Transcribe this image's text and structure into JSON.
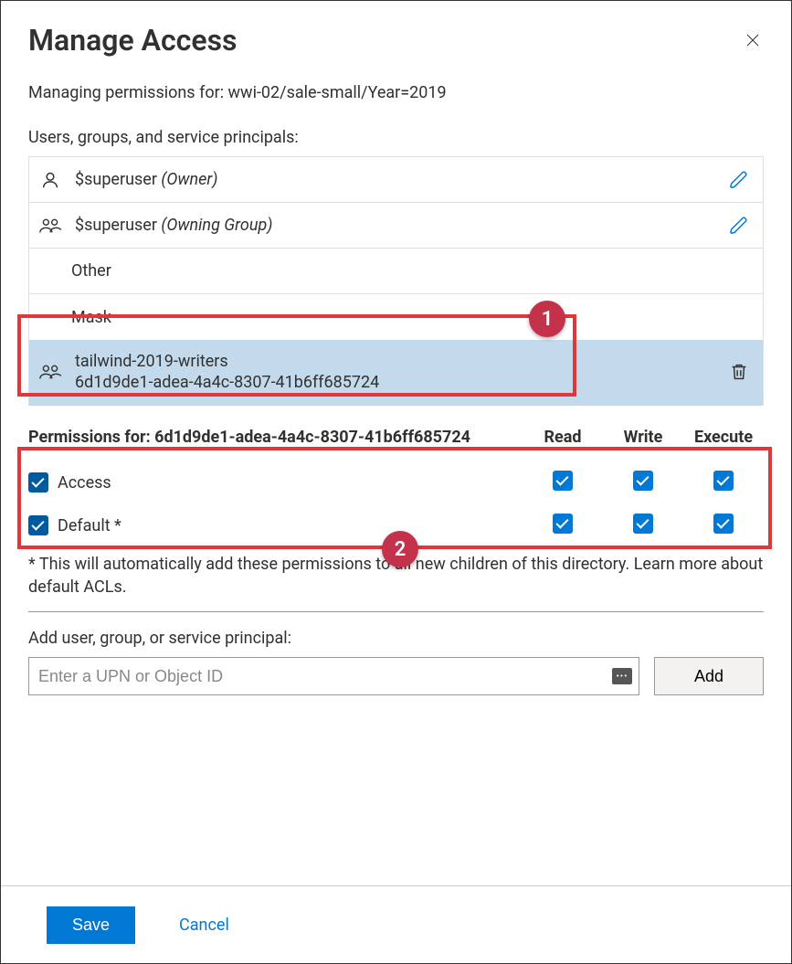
{
  "header": {
    "title": "Manage Access"
  },
  "context_line": "Managing permissions for: wwi-02/sale-small/Year=2019",
  "principals_label": "Users, groups, and service principals:",
  "principals": {
    "owner_name": "$superuser",
    "owner_role": "(Owner)",
    "owning_group_name": "$superuser",
    "owning_group_role": "(Owning Group)",
    "other_label": "Other",
    "mask_label": "Mask",
    "selected_name": "tailwind-2019-writers",
    "selected_id": "6d1d9de1-adea-4a4c-8307-41b6ff685724"
  },
  "permissions": {
    "for_label": "Permissions for: 6d1d9de1-adea-4a4c-8307-41b6ff685724",
    "col_read": "Read",
    "col_write": "Write",
    "col_execute": "Execute",
    "row_access": "Access",
    "row_default": "Default *",
    "access": {
      "enabled": true,
      "read": true,
      "write": true,
      "execute": true
    },
    "default": {
      "enabled": true,
      "read": true,
      "write": true,
      "execute": true
    }
  },
  "note": "* This will automatically add these permissions to all new children of this directory. Learn more about default ACLs.",
  "add_section": {
    "label": "Add user, group, or service principal:",
    "placeholder": "Enter a UPN or Object ID",
    "button": "Add"
  },
  "footer": {
    "save": "Save",
    "cancel": "Cancel"
  },
  "callouts": {
    "one": "1",
    "two": "2"
  }
}
